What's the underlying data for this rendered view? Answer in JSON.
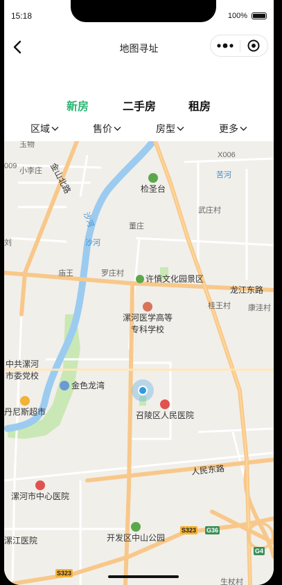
{
  "status": {
    "time": "15:18",
    "battery": "100%"
  },
  "nav": {
    "title": "地图寻址"
  },
  "tabs": [
    {
      "label": "新房",
      "active": true
    },
    {
      "label": "二手房",
      "active": false
    },
    {
      "label": "租房",
      "active": false
    }
  ],
  "filters": [
    {
      "label": "区域"
    },
    {
      "label": "售价"
    },
    {
      "label": "房型"
    },
    {
      "label": "更多"
    }
  ],
  "colors": {
    "accent": "#2bb673",
    "water": "#9ccbf0",
    "main_road": "#f8c88a",
    "green_area": "#c9e8b5",
    "locate": "#2c9be0"
  },
  "map": {
    "labels": {
      "x006": "X006",
      "road_009": "009",
      "xiaolizhuang": "小李庄",
      "jinshanbeilu": "金山北路",
      "shahe_river_1": "沙河",
      "shahe_river_2": "沙河",
      "jiantai": "检圣台",
      "kuhe": "苦河",
      "wuzhuangcun": "武庄村",
      "dongzhuang": "董庄",
      "liu": "刘",
      "miaowang": "庙王",
      "luozhuangcun": "罗庄村",
      "xushen_park": "许慎文化园景区",
      "luohe_east_road": "龙江东路",
      "guiwangcun": "桂王村",
      "kangwacun": "康洼村",
      "luohe_medical_1": "漯河医学高等",
      "luohe_medical_2": "专科学校",
      "party_school_1": "中共漯河",
      "party_school_2": "市委党校",
      "jinselongwan": "金色龙湾",
      "tangnisi": "丹尼斯超市",
      "zhaoling_hospital": "召陵区人民医院",
      "renmin_east_road": "人民东路",
      "central_hospital": "漯河市中心医院",
      "jiang_hospital": "漯江医院",
      "zhongshan_park": "开发区中山公园",
      "shengzhuangcun": "生杖村",
      "s323_a": "S323",
      "s323_b": "S323",
      "g36": "G36",
      "g4": "G4",
      "yuwucun": "玉物"
    }
  }
}
